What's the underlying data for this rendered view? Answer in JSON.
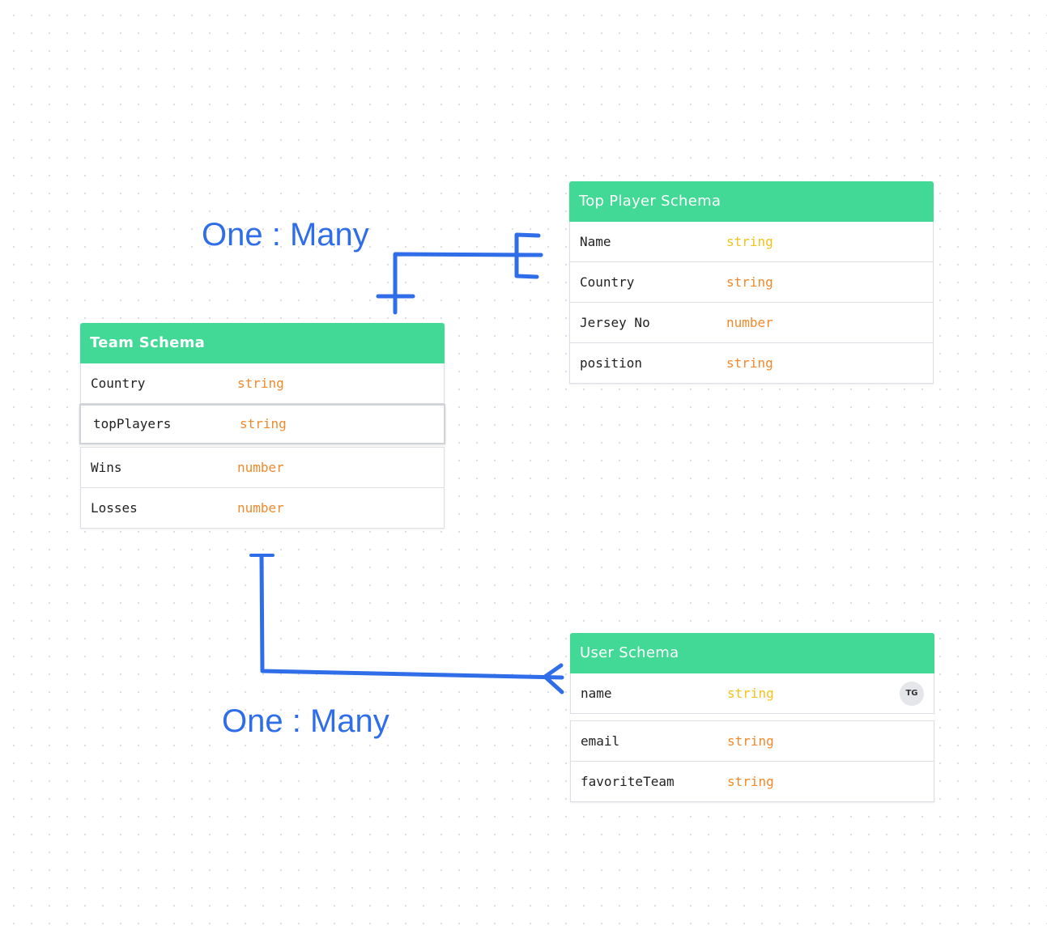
{
  "schemas": {
    "team": {
      "title": "Team Schema",
      "fields": [
        {
          "name": "Country",
          "type": "string"
        },
        {
          "name": "topPlayers",
          "type": "string"
        },
        {
          "name": "Wins",
          "type": "number"
        },
        {
          "name": "Losses",
          "type": "number"
        }
      ]
    },
    "top_player": {
      "title": "Top Player Schema",
      "fields": [
        {
          "name": "Name",
          "type": "string"
        },
        {
          "name": "Country",
          "type": "string"
        },
        {
          "name": "Jersey No",
          "type": "number"
        },
        {
          "name": "position",
          "type": "string"
        }
      ]
    },
    "user": {
      "title": "User Schema",
      "fields": [
        {
          "name": "name",
          "type": "string",
          "avatar": "TG"
        },
        {
          "name": "email",
          "type": "string"
        },
        {
          "name": "favoriteTeam",
          "type": "string"
        }
      ]
    }
  },
  "relations": [
    {
      "label": "One : Many"
    },
    {
      "label": "One : Many"
    }
  ],
  "colors": {
    "header": "#41d995",
    "type_text": "#f08a2c",
    "type_text_light": "#f2c31b",
    "connector": "#2f6ee8"
  }
}
